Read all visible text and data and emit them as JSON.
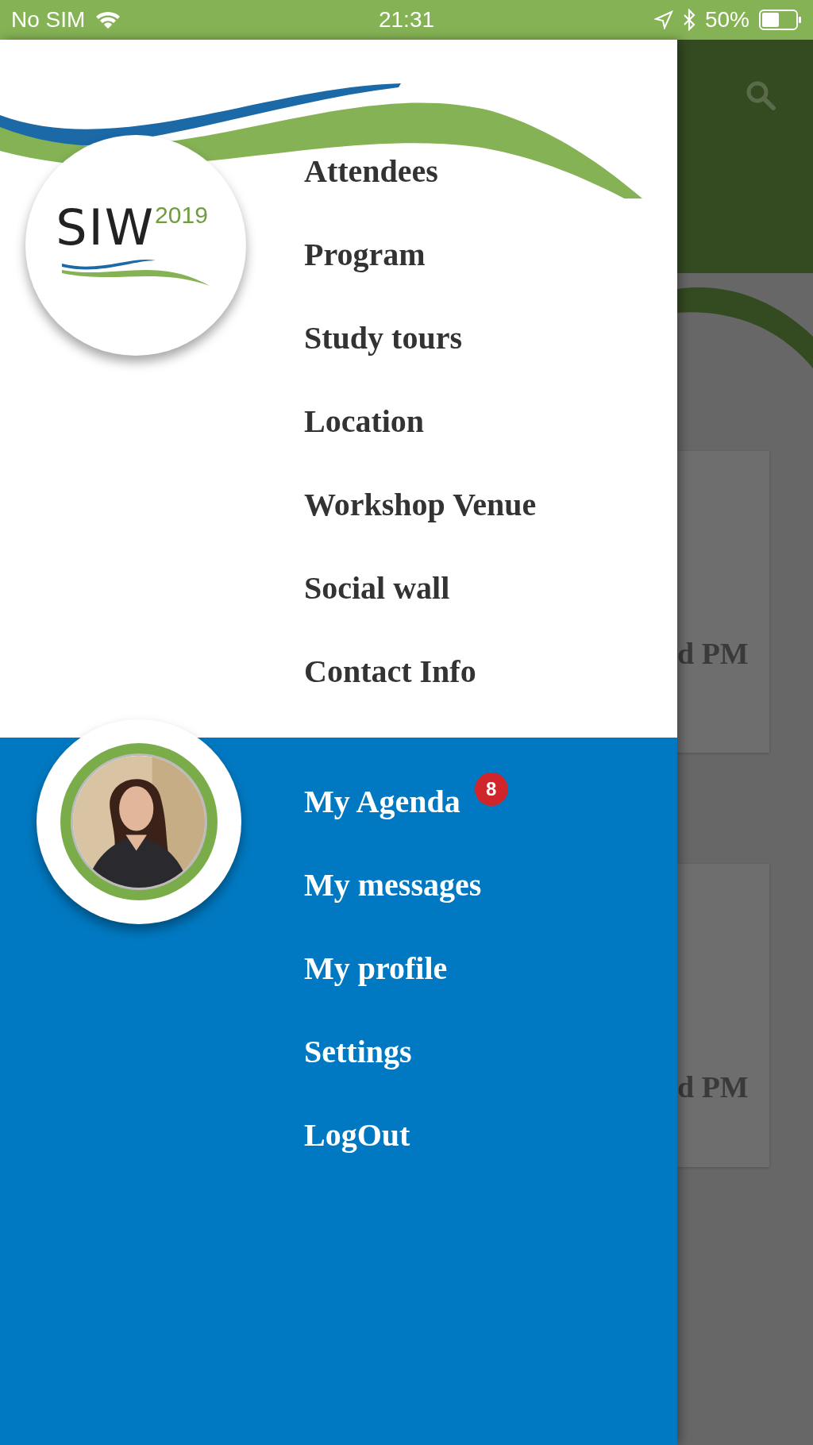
{
  "status_bar": {
    "carrier": "No SIM",
    "time": "21:31",
    "battery": "50%"
  },
  "drawer": {
    "logo": {
      "text": "SIW",
      "year": "2019"
    },
    "main_menu": [
      {
        "label": "Attendees"
      },
      {
        "label": "Program"
      },
      {
        "label": "Study tours"
      },
      {
        "label": "Location"
      },
      {
        "label": "Workshop Venue"
      },
      {
        "label": "Social wall"
      },
      {
        "label": "Contact Info"
      }
    ],
    "user_menu": [
      {
        "label": "My Agenda",
        "badge": "8"
      },
      {
        "label": "My messages"
      },
      {
        "label": "My profile"
      },
      {
        "label": "Settings"
      },
      {
        "label": "LogOut"
      }
    ]
  },
  "background": {
    "cards": [
      {
        "text": "d PM"
      },
      {
        "text": "d PM"
      }
    ]
  }
}
